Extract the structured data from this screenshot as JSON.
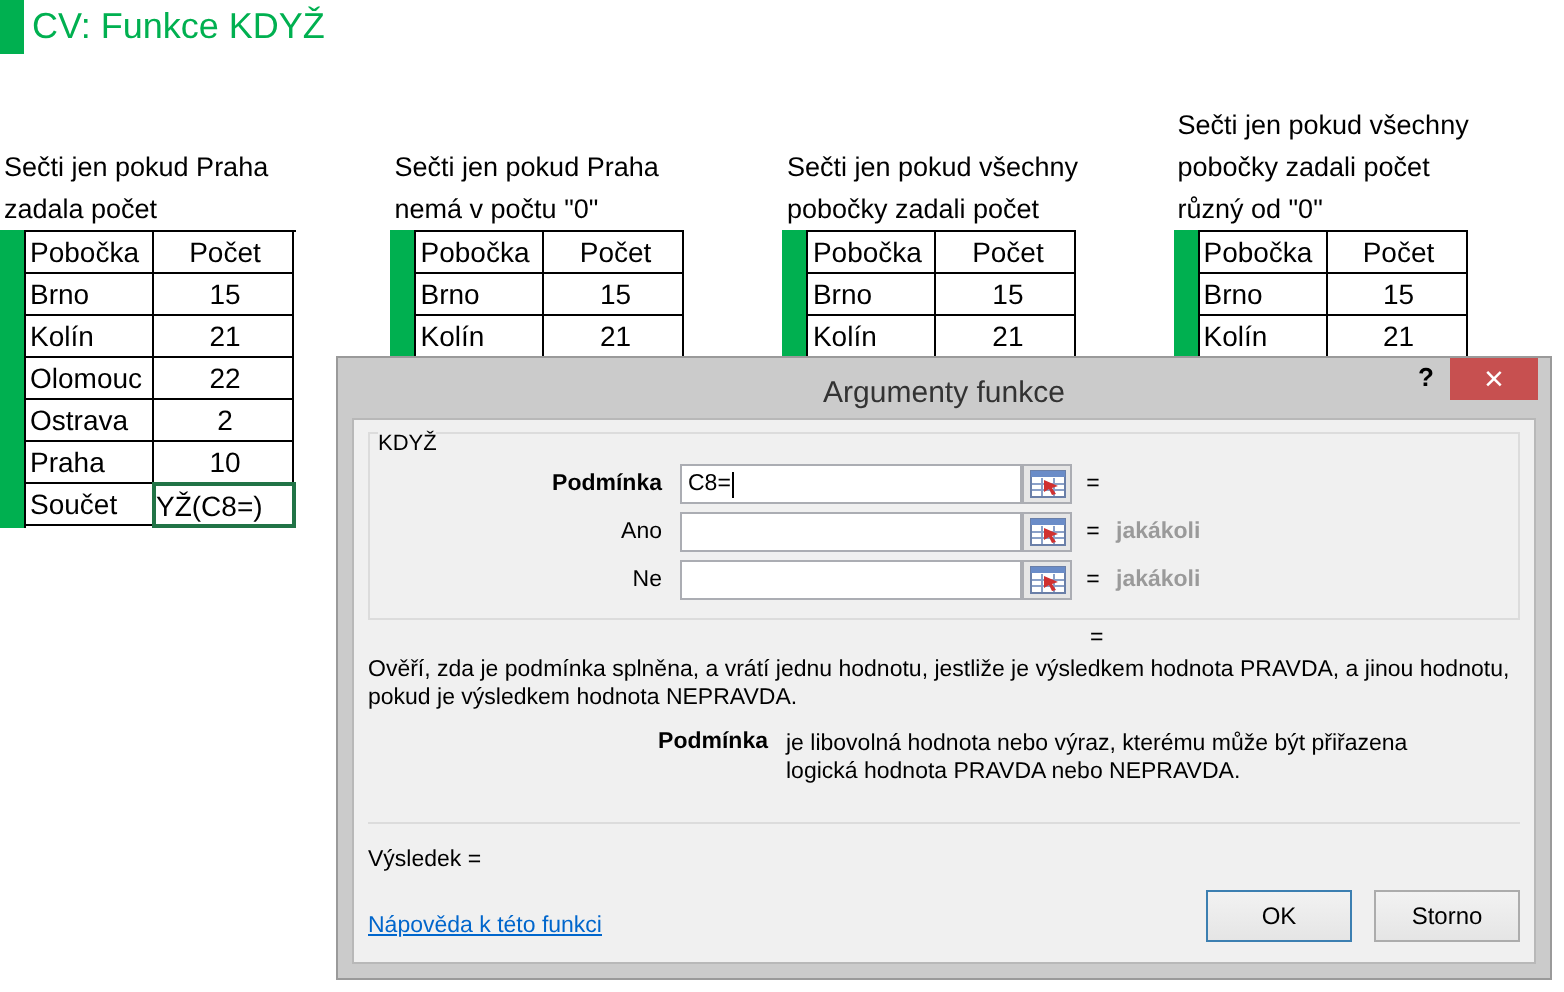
{
  "title": "CV: Funkce KDYŽ",
  "blocks": [
    {
      "heading": "Sečti jen pokud Praha zadala počet",
      "columns": [
        "Pobočka",
        "Počet"
      ],
      "rows": [
        [
          "Brno",
          "15"
        ],
        [
          "Kolín",
          "21"
        ],
        [
          "Olomouc",
          "22"
        ],
        [
          "Ostrava",
          "2"
        ],
        [
          "Praha",
          "10"
        ]
      ],
      "total": {
        "label": "Součet",
        "value": "YŽ(C8=)",
        "selected": true
      }
    },
    {
      "heading": "Sečti jen pokud Praha nemá v počtu \"0\"",
      "columns": [
        "Pobočka",
        "Počet"
      ],
      "rows": [
        [
          "Brno",
          "15"
        ],
        [
          "Kolín",
          "21"
        ]
      ]
    },
    {
      "heading": "Sečti jen pokud všechny pobočky zadali počet",
      "columns": [
        "Pobočka",
        "Počet"
      ],
      "rows": [
        [
          "Brno",
          "15"
        ],
        [
          "Kolín",
          "21"
        ]
      ]
    },
    {
      "heading": "Sečti jen pokud všechny pobočky zadali počet různý od \"0\"",
      "columns": [
        "Pobočka",
        "Počet"
      ],
      "rows": [
        [
          "Brno",
          "15"
        ],
        [
          "Kolín",
          "21"
        ]
      ]
    }
  ],
  "dialog": {
    "title": "Argumenty funkce",
    "help": "?",
    "close": "×",
    "function": "KDYŽ",
    "arguments": [
      {
        "label": "Podmínka",
        "value": "C8=",
        "selected": true,
        "equals": "="
      },
      {
        "label": "Ano",
        "selected": false,
        "equals": "=",
        "result": "jakákoli"
      },
      {
        "label": "Ne",
        "selected": false,
        "equals": "=",
        "result": "jakákoli"
      }
    ],
    "formula_result": "=",
    "description": "Ověří, zda je podmínka splněna, a vrátí jednu hodnotu, jestliže je výsledkem hodnota PRAVDA, a jinou hodnotu, pokud je výsledkem hodnota NEPRAVDA.",
    "argument_help": {
      "name": "Podmínka",
      "text": "je libovolná hodnota nebo výraz, kterému může být přiřazena logická hodnota PRAVDA nebo NEPRAVDA."
    },
    "result_label": "Výsledek =",
    "help_link": "Nápověda k této funkci",
    "buttons": [
      {
        "label": "OK",
        "default": true
      },
      {
        "label": "Storno",
        "default": false
      }
    ]
  }
}
